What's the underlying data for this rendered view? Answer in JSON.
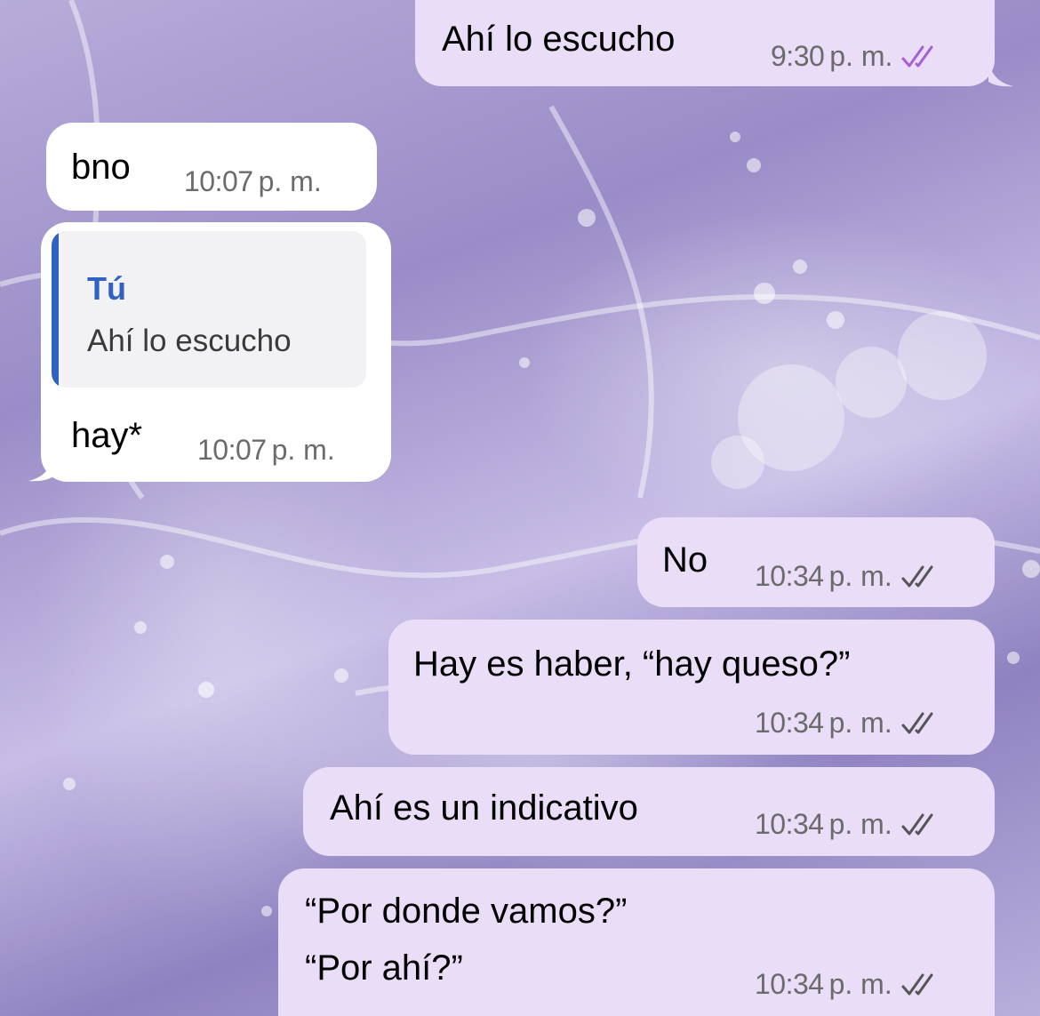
{
  "messages": [
    {
      "text": "Ahí lo escucho",
      "time": "9:30",
      "ampm": "p. m.",
      "status": "read"
    },
    {
      "text": "bno",
      "time": "10:07",
      "ampm": "p. m."
    },
    {
      "reply_author": "Tú",
      "reply_text": "Ahí lo escucho",
      "text": "hay*",
      "time": "10:07",
      "ampm": "p. m."
    },
    {
      "text": "No",
      "time": "10:34",
      "ampm": "p. m.",
      "status": "delivered"
    },
    {
      "text": "Hay es haber, “hay queso?”",
      "time": "10:34",
      "ampm": "p. m.",
      "status": "delivered"
    },
    {
      "text": "Ahí es un indicativo",
      "time": "10:34",
      "ampm": "p. m.",
      "status": "delivered"
    },
    {
      "text_line1": "“Por donde vamos?”",
      "text_line2": "“Por ahí?”",
      "time": "10:34",
      "ampm": "p. m.",
      "status": "delivered"
    }
  ],
  "colors": {
    "incoming_bubble": "#ffffff",
    "outgoing_bubble": "#e9ddf7",
    "read_check": "#a65fd6",
    "delivered_check": "#555555",
    "reply_accent": "#2f62c2"
  }
}
